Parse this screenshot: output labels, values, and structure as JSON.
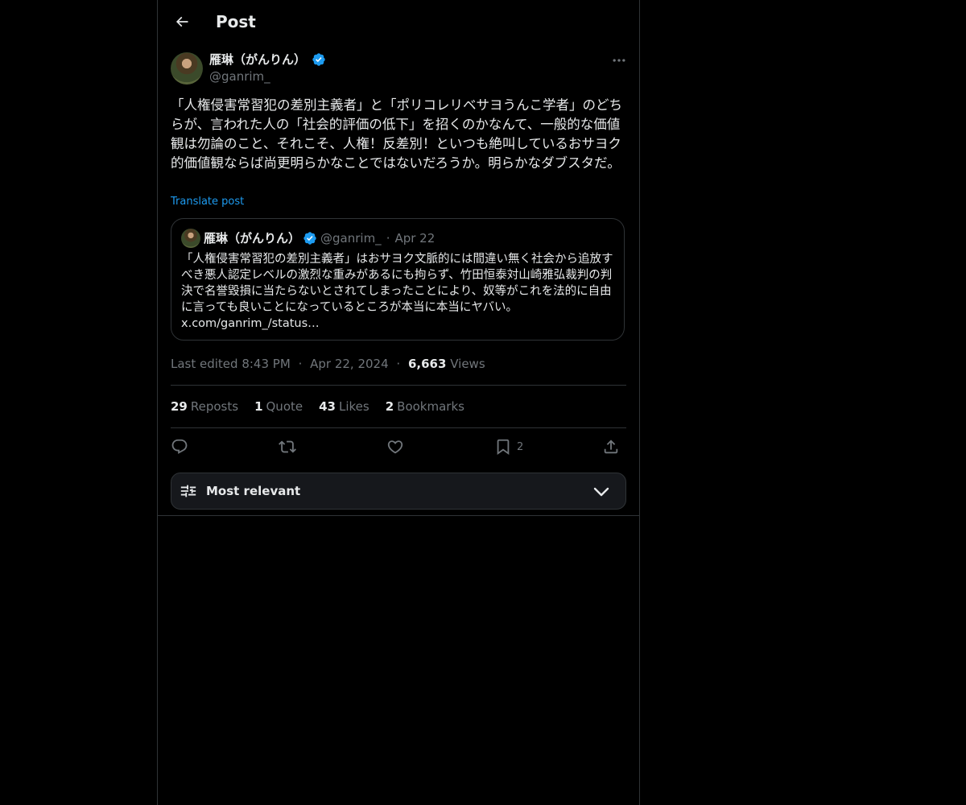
{
  "header": {
    "title": "Post"
  },
  "post": {
    "author_name": "雁琳（がんりん）",
    "author_handle": "@ganrim_",
    "text": "「人権侵害常習犯の差別主義者」と「ポリコレリベサヨうんこ学者」のどちらが、言われた人の「社会的評価の低下」を招くのかなんて、一般的な価値観は勿論のこと、それこそ、人権！反差別！といつも絶叫しているおサヨク的価値観ならば尚更明らかなことではないだろうか。明らかなダブスタだ。",
    "translate_label": "Translate post"
  },
  "quote": {
    "author_name": "雁琳（がんりん）",
    "author_handle": "@ganrim_",
    "separator": "·",
    "date": "Apr 22",
    "text": "「人権侵害常習犯の差別主義者」はおサヨク文脈的には間違い無く社会から追放すべき悪人認定レベルの激烈な重みがあるにも拘らず、竹田恒泰対山崎雅弘裁判の判決で名誉毀損に当たらないとされてしまったことにより、奴等がこれを法的に自由に言っても良いことになっているところが本当に本当にヤバい。\nx.com/ganrim_/status…"
  },
  "meta": {
    "edited_label": "Last edited 8:43 PM",
    "separator": "·",
    "date": "Apr 22, 2024",
    "views_count": "6,663",
    "views_label": "Views"
  },
  "stats": {
    "reposts_count": "29",
    "reposts_label": "Reposts",
    "quotes_count": "1",
    "quotes_label": "Quote",
    "likes_count": "43",
    "likes_label": "Likes",
    "bookmarks_count": "2",
    "bookmarks_label": "Bookmarks"
  },
  "actions": {
    "reply_icon": "reply-icon",
    "repost_icon": "repost-icon",
    "like_icon": "heart-icon",
    "bookmark_icon": "bookmark-icon",
    "bookmark_count": "2",
    "share_icon": "share-icon"
  },
  "sort": {
    "label": "Most relevant"
  },
  "colors": {
    "background": "#000000",
    "text": "#e7e9ea",
    "secondary_text": "#71767b",
    "accent": "#1d9bf0",
    "border": "#2f3336",
    "verified": "#1d9bf0"
  }
}
